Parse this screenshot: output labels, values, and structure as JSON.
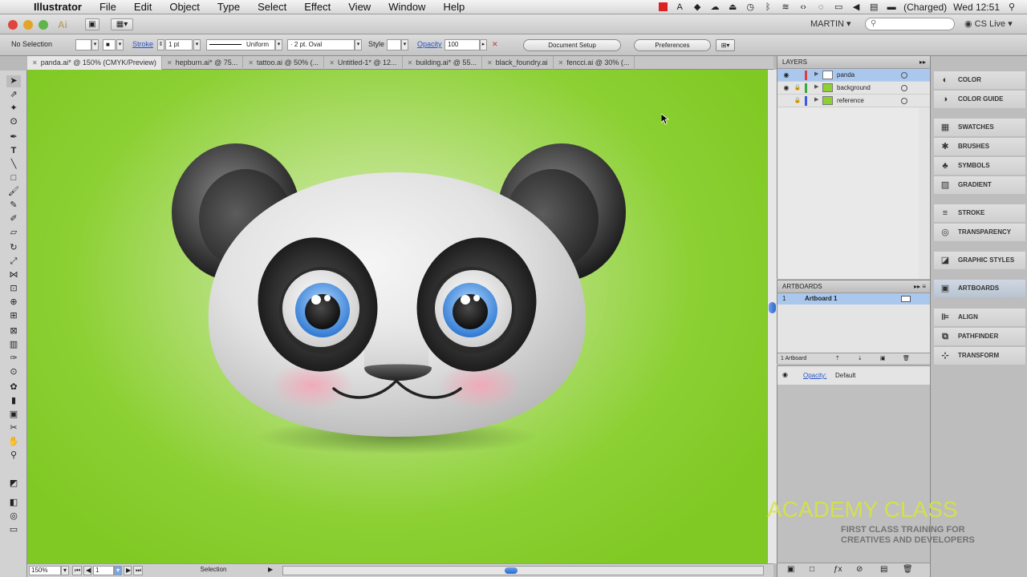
{
  "menubar": {
    "app": "Illustrator",
    "items": [
      "File",
      "Edit",
      "Object",
      "Type",
      "Select",
      "Effect",
      "View",
      "Window",
      "Help"
    ],
    "battery": "(Charged)",
    "clock": "Wed 12:51"
  },
  "appbar": {
    "workspace": "MARTIN",
    "search_placeholder": "",
    "cslive": "CS Live"
  },
  "control": {
    "selection": "No Selection",
    "stroke_label": "Stroke",
    "stroke_weight": "1 pt",
    "profile": "Uniform",
    "brush": "2 pt. Oval",
    "style_label": "Style",
    "opacity_label": "Opacity",
    "opacity_value": "100",
    "doc_setup": "Document Setup",
    "preferences": "Preferences"
  },
  "tabs": [
    {
      "label": "panda.ai* @ 150% (CMYK/Preview)",
      "active": true
    },
    {
      "label": "hepburn.ai* @ 75..."
    },
    {
      "label": "tattoo.ai @ 50% (..."
    },
    {
      "label": "Untitled-1* @ 12..."
    },
    {
      "label": "building.ai* @ 55..."
    },
    {
      "label": "black_foundry.ai"
    },
    {
      "label": "fencci.ai @ 30% (..."
    }
  ],
  "layers": {
    "title": "LAYERS",
    "rows": [
      {
        "name": "panda",
        "color": "#e23b3b",
        "selected": true
      },
      {
        "name": "background",
        "color": "#3aa83a"
      },
      {
        "name": "reference",
        "color": "#3a5ae2"
      }
    ]
  },
  "artboards": {
    "title": "ARTBOARDS",
    "rows": [
      {
        "num": "1",
        "name": "Artboard 1"
      }
    ],
    "count": "1 Artboard"
  },
  "transparency": {
    "opacity_label": "Opacity:",
    "mode": "Default"
  },
  "dock": [
    {
      "label": "COLOR",
      "icon": "color-icon"
    },
    {
      "label": "COLOR GUIDE",
      "icon": "color-guide-icon"
    },
    {
      "label": "SWATCHES",
      "icon": "swatches-icon"
    },
    {
      "label": "BRUSHES",
      "icon": "brushes-icon"
    },
    {
      "label": "SYMBOLS",
      "icon": "symbols-icon"
    },
    {
      "label": "GRADIENT",
      "icon": "gradient-icon"
    },
    {
      "label": "STROKE",
      "icon": "stroke-icon"
    },
    {
      "label": "TRANSPARENCY",
      "icon": "transparency-icon"
    },
    {
      "label": "GRAPHIC STYLES",
      "icon": "graphic-styles-icon"
    },
    {
      "label": "ARTBOARDS",
      "icon": "artboards-icon"
    },
    {
      "label": "ALIGN",
      "icon": "align-icon"
    },
    {
      "label": "PATHFINDER",
      "icon": "pathfinder-icon"
    },
    {
      "label": "TRANSFORM",
      "icon": "transform-icon"
    }
  ],
  "statusbar": {
    "zoom": "150%",
    "artboard": "1",
    "tool": "Selection"
  },
  "watermark": {
    "title": "ACADEMY CLASS",
    "line1": "FIRST CLASS TRAINING FOR",
    "line2": "CREATIVES AND DEVELOPERS"
  },
  "colors": {
    "canvas_green": "#8cd034",
    "selection_blue": "#aac8ee",
    "watermark_yellow": "#d7e63a"
  }
}
